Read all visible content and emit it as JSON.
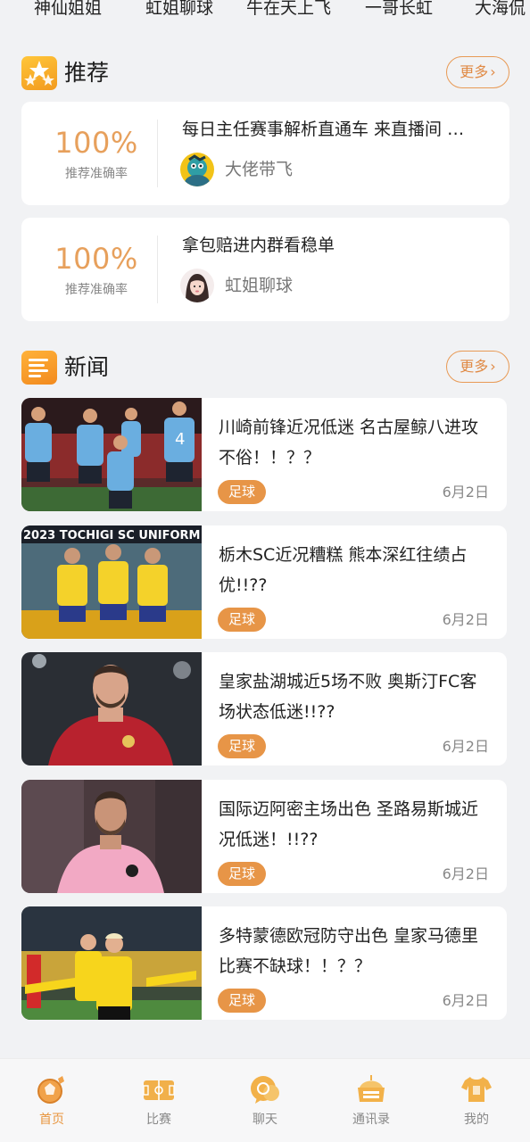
{
  "host_tabs": [
    "神仙姐姐",
    "虹姐聊球",
    "牛在天上飞",
    "一哥长虹",
    "大海侃"
  ],
  "recommend": {
    "title": "推荐",
    "more_label": "更多",
    "cards": [
      {
        "rate": "100%",
        "rate_label": "推荐准确率",
        "title": "每日主任赛事解析直通车 来直播间 …",
        "author": "大佬带飞"
      },
      {
        "rate": "100%",
        "rate_label": "推荐准确率",
        "title": "拿包赔进内群看稳单",
        "author": "虹姐聊球"
      }
    ]
  },
  "news": {
    "title": "新闻",
    "more_label": "更多",
    "items": [
      {
        "title": "川崎前锋近况低迷 名古屋鲸八进攻不俗！！？？",
        "tag": "足球",
        "date": "6月2日",
        "image": "kawasaki-players-celebrating"
      },
      {
        "title": "栃木SC近况糟糕 熊本深红往绩占优!!??",
        "tag": "足球",
        "date": "6月2日",
        "image": "tochigi-sc-uniform-poster"
      },
      {
        "title": "皇家盐湖城近5场不败 奥斯汀FC客场状态低迷!!??",
        "tag": "足球",
        "date": "6月2日",
        "image": "real-salt-lake-player-portrait"
      },
      {
        "title": "国际迈阿密主场出色 圣路易斯城近况低迷！!!??",
        "tag": "足球",
        "date": "6月2日",
        "image": "inter-miami-player-portrait"
      },
      {
        "title": "多特蒙德欧冠防守出色 皇家马德里比赛不缺球！！？？",
        "tag": "足球",
        "date": "6月2日",
        "image": "dortmund-player-celebrating"
      }
    ],
    "thumb_text": {
      "tochigi_banner": "2023 TOCHIGI SC UNIFORM"
    }
  },
  "bottom_nav": [
    {
      "label": "首页",
      "icon": "home-football-icon",
      "active": true
    },
    {
      "label": "比赛",
      "icon": "match-pitch-icon",
      "active": false
    },
    {
      "label": "聊天",
      "icon": "chat-bubble-icon",
      "active": false
    },
    {
      "label": "通讯录",
      "icon": "contacts-stadium-icon",
      "active": false
    },
    {
      "label": "我的",
      "icon": "profile-jersey-icon",
      "active": false
    }
  ],
  "colors": {
    "accent": "#e8963f",
    "rate": "#e7a05c",
    "background": "#f1f2f4"
  }
}
